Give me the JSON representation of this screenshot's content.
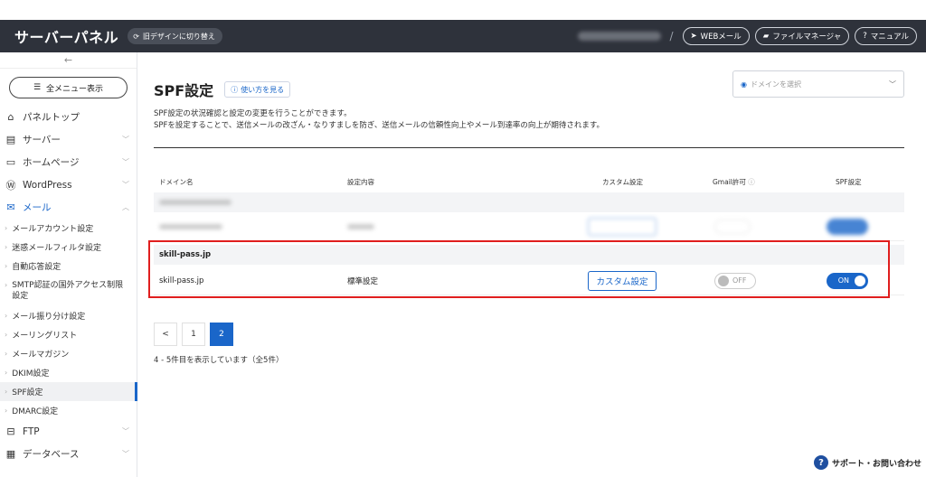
{
  "header": {
    "brand": "サーバーパネル",
    "switch_label": "旧デザインに切り替え",
    "webmail": "WEBメール",
    "file_manager": "ファイルマネージャ",
    "manual": "マニュアル"
  },
  "sidebar": {
    "all_menu": "全メニュー表示",
    "items": [
      {
        "label": "パネルトップ"
      },
      {
        "label": "サーバー"
      },
      {
        "label": "ホームページ"
      },
      {
        "label": "WordPress"
      },
      {
        "label": "メール"
      }
    ],
    "mail_sub": [
      "メールアカウント設定",
      "迷惑メールフィルタ設定",
      "自動応答設定",
      "SMTP認証の国外アクセス制限設定",
      "メール振り分け設定",
      "メーリングリスト",
      "メールマガジン",
      "DKIM設定",
      "SPF設定",
      "DMARC設定"
    ],
    "items_after": [
      {
        "label": "FTP"
      },
      {
        "label": "データベース"
      }
    ]
  },
  "main": {
    "title": "SPF設定",
    "howto": "使い方を見る",
    "domain_placeholder": "ドメインを選択",
    "desc_line1": "SPF設定の状況確認と設定の変更を行うことができます。",
    "desc_line2": "SPFを設定することで、送信メールの改ざん・なりすましを防ぎ、送信メールの信頼性向上やメール到達率の向上が期待されます。",
    "columns": {
      "domain": "ドメイン名",
      "setting": "設定内容",
      "custom": "カスタム設定",
      "gmail": "Gmail許可",
      "spf": "SPF設定"
    },
    "row": {
      "group": "skill-pass.jp",
      "domain": "skill-pass.jp",
      "setting": "標準設定",
      "custom_btn": "カスタム設定",
      "gmail_state": "OFF",
      "spf_state": "ON"
    },
    "pager": [
      "<",
      "1",
      "2"
    ],
    "count_text": "4 - 5件目を表示しています（全5件）"
  },
  "support": "サポート・お問い合わせ",
  "colors": {
    "accent": "#1a66c9",
    "header_bg": "#2e323b",
    "highlight": "#e01e1e"
  }
}
